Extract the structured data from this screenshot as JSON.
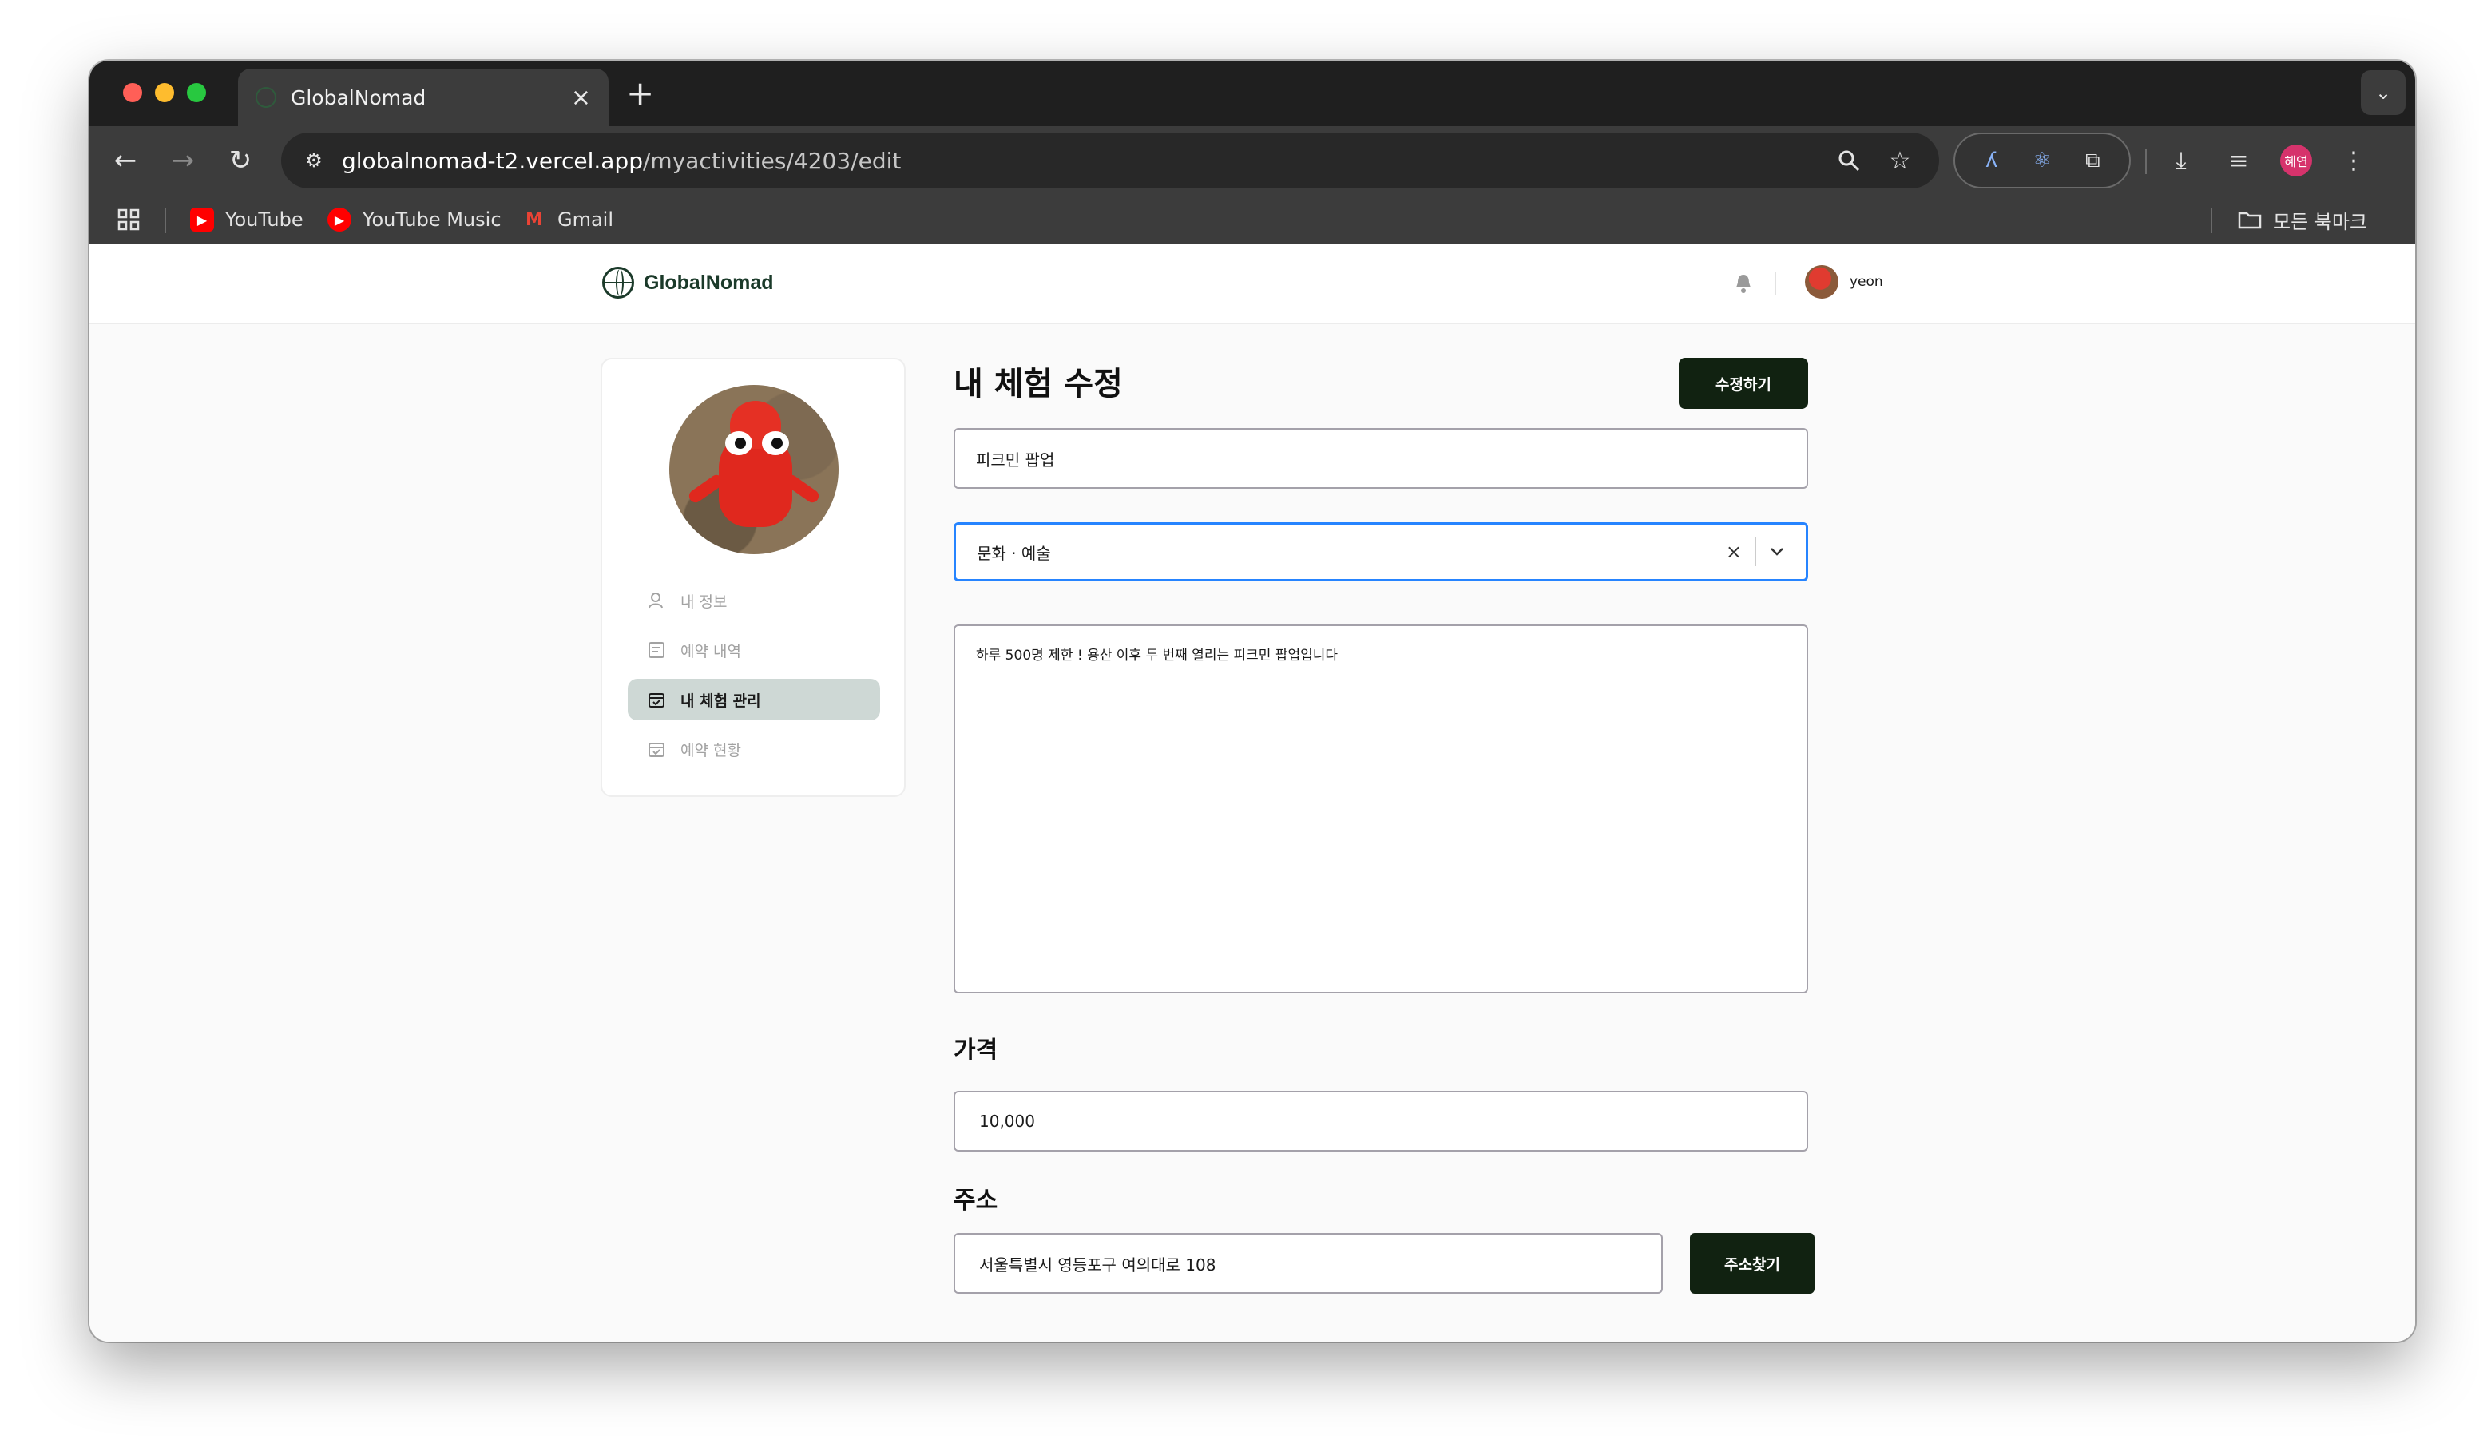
{
  "browser": {
    "tab_title": "GlobalNomad",
    "new_tab": "+",
    "url_host": "globalnomad-t2.vercel.app",
    "url_path": "/myactivities/4203/edit",
    "profile_badge": "혜연",
    "bookmarks": [
      {
        "label": "YouTube",
        "icon": "youtube-icon",
        "color": "#ff0000"
      },
      {
        "label": "YouTube Music",
        "icon": "youtube-music-icon",
        "color": "#ff0000"
      },
      {
        "label": "Gmail",
        "icon": "gmail-icon",
        "color": "#ea4335"
      }
    ],
    "all_bookmarks": "모든 북마크"
  },
  "site": {
    "logo_text": "GlobalNomad",
    "user_name": "yeon"
  },
  "sidebar": {
    "items": [
      {
        "label": "내 정보",
        "icon": "user-icon",
        "active": false
      },
      {
        "label": "예약 내역",
        "icon": "list-icon",
        "active": false
      },
      {
        "label": "내 체험 관리",
        "icon": "calendar-check-icon",
        "active": true
      },
      {
        "label": "예약 현황",
        "icon": "calendar-icon",
        "active": false
      }
    ]
  },
  "main": {
    "title": "내 체험 수정",
    "submit_label": "수정하기",
    "activity_title": "피크민 팝업",
    "category": "문화 · 예술",
    "description": "하루 500명 제한 ! 용산 이후 두 번째 열리는 피크민 팝업입니다",
    "price_label": "가격",
    "price_value": "10,000",
    "address_label": "주소",
    "address_value": "서울특별시 영등포구 여의대로 108",
    "address_button": "주소찾기"
  },
  "colors": {
    "accent_dark": "#112211",
    "active_menu_bg": "#ced8d5",
    "focus_border": "#2684ff"
  }
}
